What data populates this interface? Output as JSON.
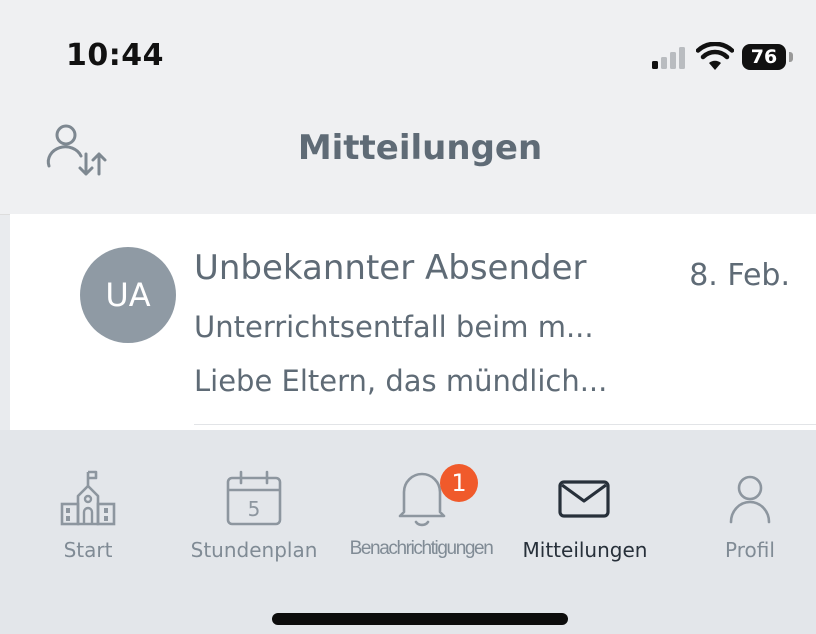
{
  "status_bar": {
    "time": "10:44",
    "battery": "76"
  },
  "header": {
    "title": "Mitteilungen",
    "left_icon": "switch-user-icon"
  },
  "messages": [
    {
      "avatar_initials": "UA",
      "sender": "Unbekannter Absender",
      "date": "8. Feb.",
      "subject": "Unterrichtsentfall beim m...",
      "preview": "Liebe Eltern, das mündlich..."
    }
  ],
  "tabs": [
    {
      "label": "Start",
      "icon": "school-icon",
      "active": false
    },
    {
      "label": "Stundenplan",
      "icon": "calendar-icon",
      "active": false
    },
    {
      "label": "Benachrichtigungen",
      "icon": "bell-icon",
      "active": false,
      "badge": "1"
    },
    {
      "label": "Mitteilungen",
      "icon": "envelope-icon",
      "active": true
    },
    {
      "label": "Profil",
      "icon": "person-icon",
      "active": false
    }
  ],
  "colors": {
    "accent_text": "#5f6b76",
    "badge": "#f05a2b",
    "avatar": "#8f9aa4",
    "active_tab": "#27303a",
    "inactive_tab": "#808b95"
  }
}
